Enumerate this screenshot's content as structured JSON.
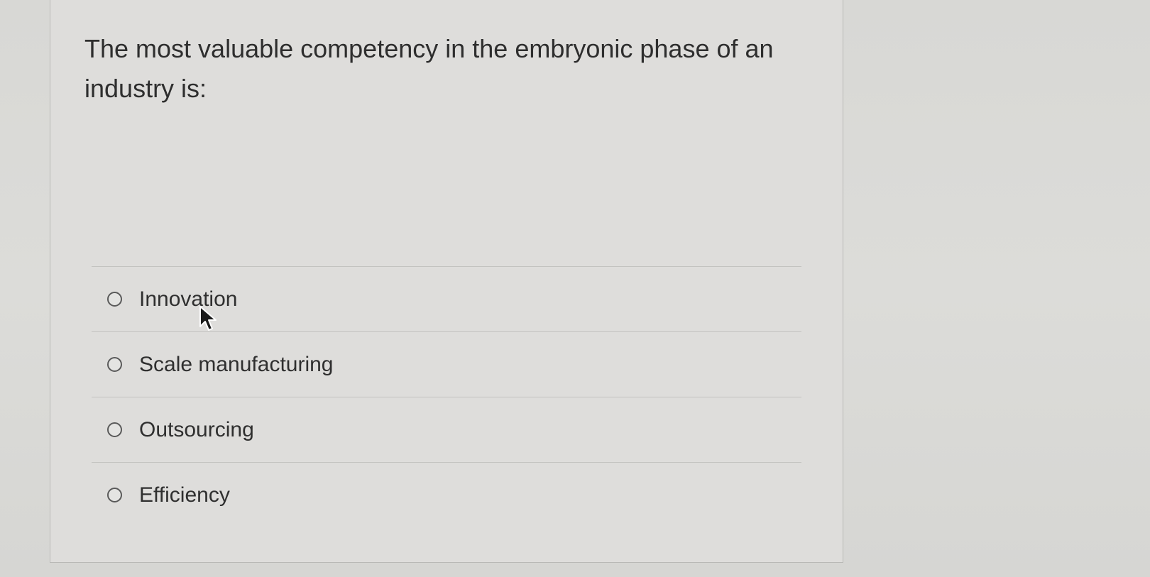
{
  "question": {
    "text": "The most valuable competency in the embryonic phase of an industry is:"
  },
  "options": [
    {
      "label": "Innovation",
      "selected": false
    },
    {
      "label": "Scale manufacturing",
      "selected": false
    },
    {
      "label": "Outsourcing",
      "selected": false
    },
    {
      "label": "Efficiency",
      "selected": false
    }
  ],
  "icons": {
    "pointer": "mouse-pointer-icon",
    "radio": "radio-circle-icon"
  },
  "colors": {
    "card_background": "#dedddb",
    "text": "#2e2e2e",
    "divider": "#c3c3c0"
  }
}
